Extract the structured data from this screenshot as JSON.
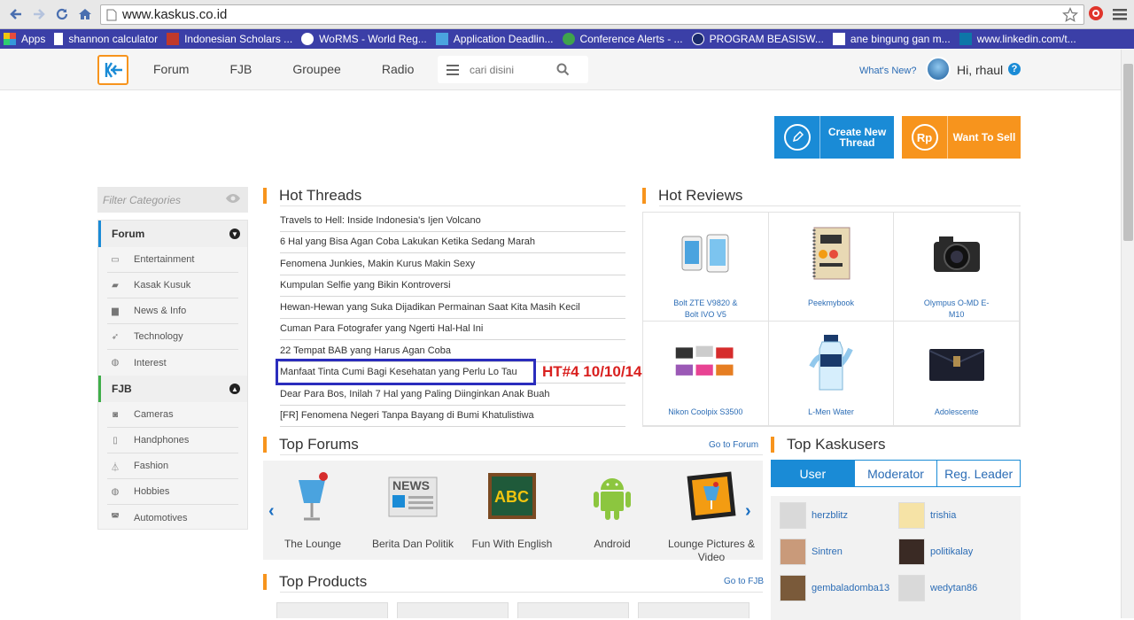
{
  "browser": {
    "url": "www.kaskus.co.id",
    "bookmarks": [
      {
        "label": "Apps",
        "icon": "apps-grid-icon"
      },
      {
        "label": "shannon calculator",
        "icon": "page-icon"
      },
      {
        "label": "Indonesian Scholars ...",
        "icon": "i5-icon"
      },
      {
        "label": "WoRMS - World Reg...",
        "icon": "worms-icon"
      },
      {
        "label": "Application Deadlin...",
        "icon": "blue-doc-icon"
      },
      {
        "label": "Conference Alerts - ...",
        "icon": "globe-icon"
      },
      {
        "label": "PROGRAM BEASISW...",
        "icon": "circle-icon"
      },
      {
        "label": "ane bingung gan m...",
        "icon": "kaskus-fav-icon"
      },
      {
        "label": "www.linkedin.com/t...",
        "icon": "linkedin-icon"
      }
    ]
  },
  "header": {
    "nav": [
      "Forum",
      "FJB",
      "Groupee",
      "Radio"
    ],
    "search_placeholder": "cari disini",
    "whats_new": "What's New?",
    "greeting": "Hi, rhaul"
  },
  "actions": {
    "create_line1": "Create New",
    "create_line2": "Thread",
    "sell": "Want To Sell",
    "sell_icon_text": "Rp"
  },
  "sidebar": {
    "filter_placeholder": "Filter Categories",
    "forum_title": "Forum",
    "forum_items": [
      "Entertainment",
      "Kasak Kusuk",
      "News & Info",
      "Technology",
      "Interest"
    ],
    "fjb_title": "FJB",
    "fjb_items": [
      "Cameras",
      "Handphones",
      "Fashion",
      "Hobbies",
      "Automotives"
    ]
  },
  "hot_threads": {
    "title": "Hot Threads",
    "items": [
      "Travels to Hell: Inside Indonesia's Ijen Volcano",
      "6 Hal yang Bisa Agan Coba Lakukan Ketika Sedang Marah",
      "Fenomena Junkies, Makin Kurus Makin Sexy",
      "Kumpulan Selfie yang Bikin Kontroversi",
      "Hewan-Hewan yang Suka Dijadikan Permainan Saat Kita Masih Kecil",
      "Cuman Para Fotografer yang Ngerti Hal-Hal Ini",
      "22 Tempat BAB yang Harus Agan Coba",
      "Manfaat Tinta Cumi Bagi Kesehatan yang Perlu Lo Tau",
      "Dear Para Bos, Inilah 7 Hal yang Paling Diinginkan Anak Buah",
      "[FR] Fenomena Negeri Tanpa Bayang di Bumi Khatulistiwa"
    ],
    "annotation": "HT#4 10/10/14"
  },
  "hot_reviews": {
    "title": "Hot Reviews",
    "items": [
      {
        "line1": "Bolt ZTE V9820 &",
        "line2": "Bolt IVO V5"
      },
      {
        "line1": "Peekmybook",
        "line2": ""
      },
      {
        "line1": "Olympus O-MD E-",
        "line2": "M10"
      },
      {
        "line1": "Nikon Coolpix S3500",
        "line2": ""
      },
      {
        "line1": "L-Men Water",
        "line2": ""
      },
      {
        "line1": "Adolescente",
        "line2": ""
      }
    ]
  },
  "top_forums": {
    "title": "Top Forums",
    "link": "Go to Forum",
    "items": [
      {
        "line1": "The Lounge",
        "line2": ""
      },
      {
        "line1": "Berita Dan Politik",
        "line2": ""
      },
      {
        "line1": "Fun With English",
        "line2": ""
      },
      {
        "line1": "Android",
        "line2": ""
      },
      {
        "line1": "Lounge Pictures &",
        "line2": "Video"
      }
    ],
    "abc_text": "ABC",
    "news_text": "NEWS"
  },
  "top_kaskusers": {
    "title": "Top Kaskusers",
    "tabs": [
      "User",
      "Moderator",
      "Reg. Leader"
    ],
    "users": [
      "herzblitz",
      "trishia",
      "Sintren",
      "politikalay",
      "gembaladomba13",
      "wedytan86"
    ]
  },
  "top_products": {
    "title": "Top Products",
    "link": "Go to FJB"
  },
  "colors": {
    "accent_orange": "#f7941d",
    "accent_blue": "#1a8bd6",
    "link_blue": "#2b6cb5",
    "annotation_red": "#d9201f",
    "highlight_box": "#2b2dbd"
  }
}
